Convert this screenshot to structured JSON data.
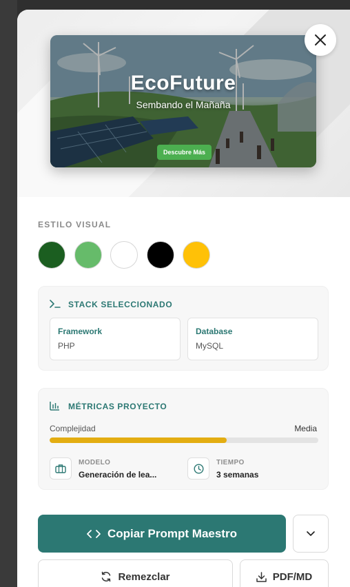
{
  "preview": {
    "title": "EcoFuture",
    "subtitle": "Sembando el Mañaña",
    "cta_label": "Descubre Más"
  },
  "visual_style": {
    "label": "ESTILO VISUAL",
    "swatches": [
      "#1b5e20",
      "#66bb6a",
      "#ffffff",
      "#000000",
      "#ffc107"
    ]
  },
  "stack": {
    "title": "STACK SELECCIONADO",
    "framework_label": "Framework",
    "framework_value": "PHP",
    "database_label": "Database",
    "database_value": "MySQL"
  },
  "metrics": {
    "title": "MÉTRICAS PROYECTO",
    "complexity_label": "Complejidad",
    "complexity_value": "Media",
    "complexity_progress": 0.66,
    "model_label": "MODELO",
    "model_value": "Generación de lea...",
    "time_label": "TIEMPO",
    "time_value": "3 semanas"
  },
  "actions": {
    "primary_label": "Copiar Prompt Maestro",
    "remix_label": "Remezclar",
    "export_label": "PDF/MD"
  },
  "colors": {
    "accent": "#2c7873",
    "progress": "#e3ad12",
    "cta_green": "#4caf50"
  },
  "icons": {
    "close": "close-icon",
    "terminal": "terminal-icon",
    "chart": "bar-chart-icon",
    "briefcase": "briefcase-icon",
    "clock": "clock-icon",
    "code": "code-icon",
    "chevron": "chevron-down-icon",
    "refresh": "refresh-icon",
    "download": "download-icon"
  }
}
